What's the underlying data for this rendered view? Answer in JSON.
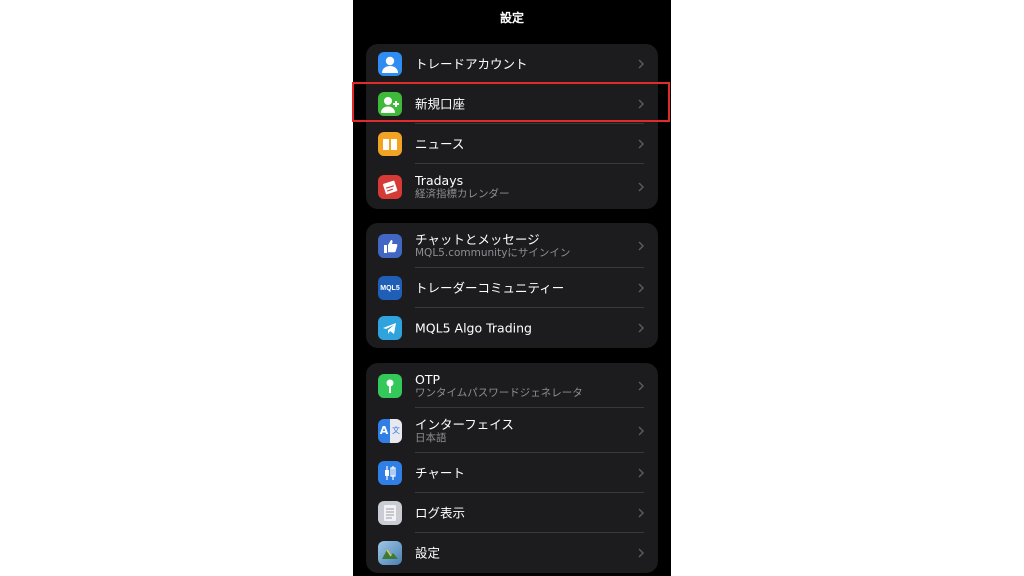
{
  "header": {
    "title": "設定"
  },
  "groups": [
    {
      "items": [
        {
          "title": "トレードアカウント",
          "icon": "person-icon"
        },
        {
          "title": "新規口座",
          "icon": "add-person-icon"
        },
        {
          "title": "ニュース",
          "icon": "book-icon"
        },
        {
          "title": "Tradays",
          "subtitle": "経済指標カレンダー",
          "icon": "tradays-icon"
        }
      ]
    },
    {
      "items": [
        {
          "title": "チャットとメッセージ",
          "subtitle": "MQL5.communityにサインイン",
          "icon": "thumbs-up-icon"
        },
        {
          "title": "トレーダーコミュニティー",
          "icon": "mql5-logo-icon",
          "icon_text": "MQL5"
        },
        {
          "title": "MQL5 Algo Trading",
          "icon": "telegram-icon"
        }
      ]
    },
    {
      "items": [
        {
          "title": "OTP",
          "subtitle": "ワンタイムパスワードジェネレータ",
          "icon": "key-icon"
        },
        {
          "title": "インターフェイス",
          "subtitle": "日本語",
          "icon": "translate-icon",
          "icon_text_a": "A",
          "icon_text_b": "文"
        },
        {
          "title": "チャート",
          "icon": "candlestick-icon"
        },
        {
          "title": "ログ表示",
          "icon": "document-icon"
        },
        {
          "title": "設定",
          "icon": "metatrader-icon"
        }
      ]
    }
  ],
  "colors": {
    "background": "#000000",
    "group_background": "#1c1c1e",
    "separator": "#38383a",
    "highlight": "#e02b2b",
    "subtitle": "#8e8e93"
  }
}
